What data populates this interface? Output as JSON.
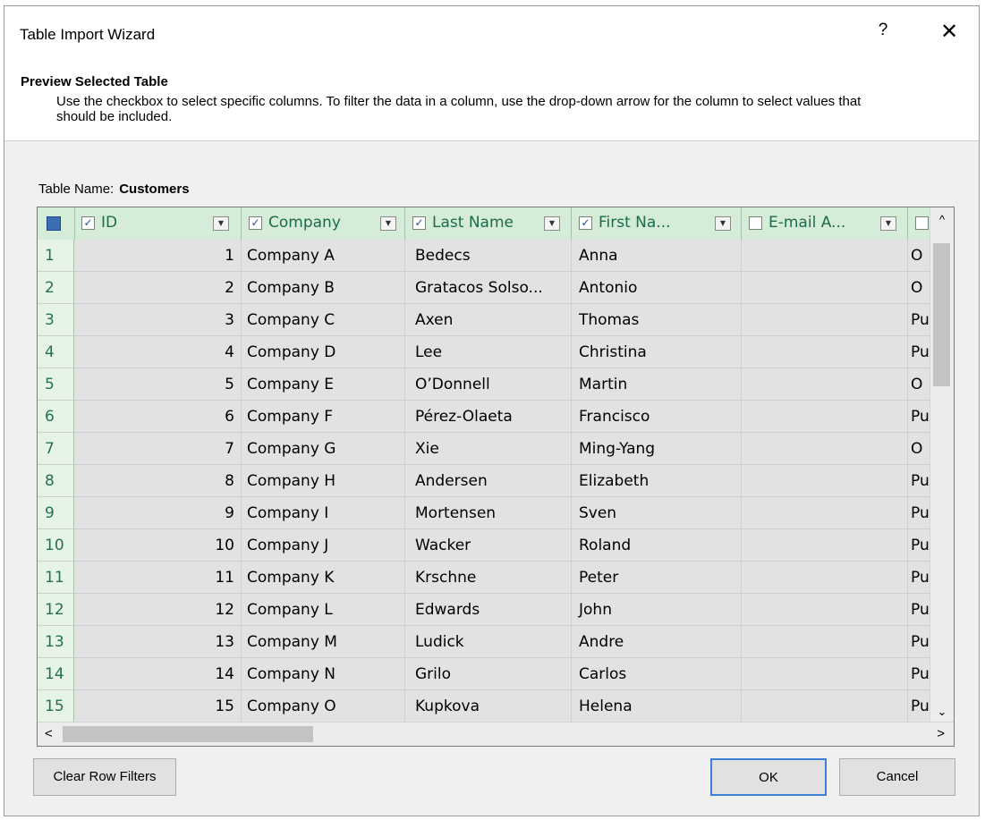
{
  "window": {
    "title": "Table Import Wizard",
    "help_label": "?",
    "close_label": "✕"
  },
  "section": {
    "title": "Preview Selected Table",
    "description": "Use the checkbox to select specific columns. To filter the data in a column, use the drop-down arrow  for the column to select values that should be included."
  },
  "table_name": {
    "label": "Table Name:",
    "value": "Customers"
  },
  "columns": [
    {
      "label": "ID",
      "checked": true
    },
    {
      "label": "Company",
      "checked": true
    },
    {
      "label": "Last Name",
      "checked": true
    },
    {
      "label": "First Na...",
      "checked": true
    },
    {
      "label": "E-mail A...",
      "checked": false
    }
  ],
  "rows": [
    {
      "n": "1",
      "id": "1",
      "company": "Company A",
      "last": "Bedecs",
      "first": "Anna",
      "email": "",
      "next": "O"
    },
    {
      "n": "2",
      "id": "2",
      "company": "Company B",
      "last": "Gratacos Solso...",
      "first": "Antonio",
      "email": "",
      "next": "O"
    },
    {
      "n": "3",
      "id": "3",
      "company": "Company C",
      "last": "Axen",
      "first": "Thomas",
      "email": "",
      "next": "Pu"
    },
    {
      "n": "4",
      "id": "4",
      "company": "Company D",
      "last": "Lee",
      "first": "Christina",
      "email": "",
      "next": "Pu"
    },
    {
      "n": "5",
      "id": "5",
      "company": "Company E",
      "last": "O’Donnell",
      "first": "Martin",
      "email": "",
      "next": "O"
    },
    {
      "n": "6",
      "id": "6",
      "company": "Company F",
      "last": "Pérez-Olaeta",
      "first": "Francisco",
      "email": "",
      "next": "Pu"
    },
    {
      "n": "7",
      "id": "7",
      "company": "Company G",
      "last": "Xie",
      "first": "Ming-Yang",
      "email": "",
      "next": "O"
    },
    {
      "n": "8",
      "id": "8",
      "company": "Company H",
      "last": "Andersen",
      "first": "Elizabeth",
      "email": "",
      "next": "Pu"
    },
    {
      "n": "9",
      "id": "9",
      "company": "Company I",
      "last": "Mortensen",
      "first": "Sven",
      "email": "",
      "next": "Pu"
    },
    {
      "n": "10",
      "id": "10",
      "company": "Company J",
      "last": "Wacker",
      "first": "Roland",
      "email": "",
      "next": "Pu"
    },
    {
      "n": "11",
      "id": "11",
      "company": "Company K",
      "last": "Krschne",
      "first": "Peter",
      "email": "",
      "next": "Pu"
    },
    {
      "n": "12",
      "id": "12",
      "company": "Company L",
      "last": "Edwards",
      "first": "John",
      "email": "",
      "next": "Pu"
    },
    {
      "n": "13",
      "id": "13",
      "company": "Company M",
      "last": "Ludick",
      "first": "Andre",
      "email": "",
      "next": "Pu"
    },
    {
      "n": "14",
      "id": "14",
      "company": "Company N",
      "last": "Grilo",
      "first": "Carlos",
      "email": "",
      "next": "Pu"
    },
    {
      "n": "15",
      "id": "15",
      "company": "Company O",
      "last": "Kupkova",
      "first": "Helena",
      "email": "",
      "next": "Pu"
    }
  ],
  "scroll": {
    "up": "^",
    "down": "⌄",
    "left": "<",
    "right": ">"
  },
  "buttons": {
    "clear_filters": "Clear Row Filters",
    "ok": "OK",
    "cancel": "Cancel"
  }
}
